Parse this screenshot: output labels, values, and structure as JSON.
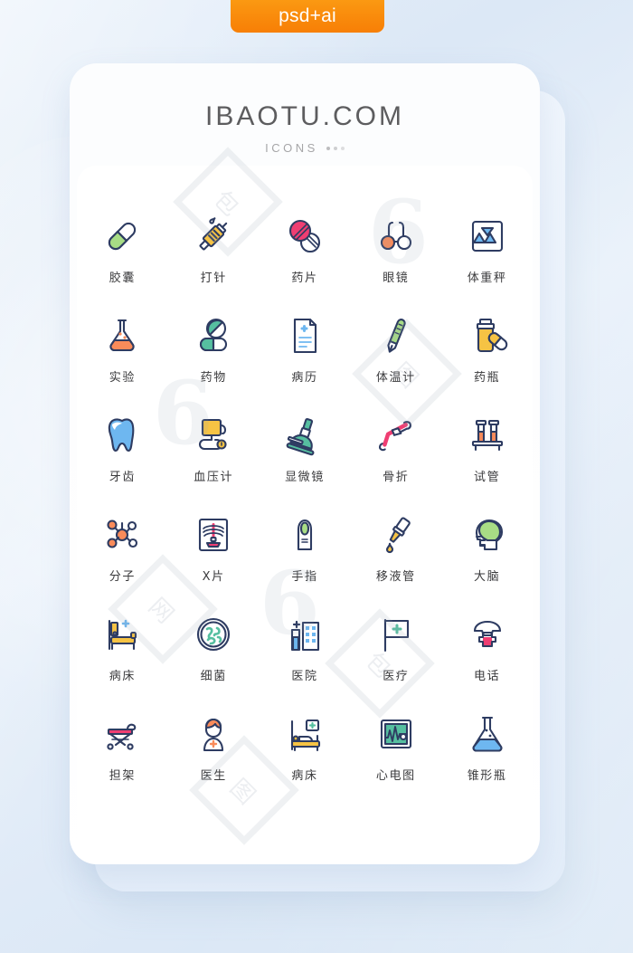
{
  "badge": {
    "label": "psd+ai"
  },
  "card": {
    "brand_title": "IBAOTU.COM",
    "brand_subtitle": "ICONS"
  },
  "colors": {
    "badge_orange": "#f98a0b",
    "outline_navy": "#2e3c62",
    "green": "#a8dd85",
    "teal": "#56bfa0",
    "pink": "#ef3e72",
    "orange": "#f98b5a",
    "yellow": "#f6c344",
    "blue": "#6eb7f0",
    "background": "#dfeaf7",
    "label_text": "#3a3a3c",
    "title_text": "#5d5d5f"
  },
  "watermarks": {
    "logo_text": "6",
    "box_text": "包图网",
    "site_text": "网"
  },
  "icons": [
    {
      "id": "capsule",
      "name": "capsule-icon",
      "label": "胶囊"
    },
    {
      "id": "injection",
      "name": "syringe-icon",
      "label": "打针"
    },
    {
      "id": "pills",
      "name": "pills-icon",
      "label": "药片"
    },
    {
      "id": "glasses",
      "name": "glasses-icon",
      "label": "眼镜"
    },
    {
      "id": "scale",
      "name": "weight-scale-icon",
      "label": "体重秤"
    },
    {
      "id": "flask",
      "name": "lab-flask-icon",
      "label": "实验"
    },
    {
      "id": "medicine",
      "name": "medicine-icon",
      "label": "药物"
    },
    {
      "id": "record",
      "name": "medical-record-icon",
      "label": "病历"
    },
    {
      "id": "thermometer",
      "name": "thermometer-icon",
      "label": "体温计"
    },
    {
      "id": "medbottle",
      "name": "medicine-bottle-icon",
      "label": "药瓶"
    },
    {
      "id": "tooth",
      "name": "tooth-icon",
      "label": "牙齿"
    },
    {
      "id": "bpmonitor",
      "name": "blood-pressure-icon",
      "label": "血压计"
    },
    {
      "id": "microscope",
      "name": "microscope-icon",
      "label": "显微镜"
    },
    {
      "id": "fracture",
      "name": "bone-fracture-icon",
      "label": "骨折"
    },
    {
      "id": "testtube",
      "name": "test-tube-icon",
      "label": "试管"
    },
    {
      "id": "molecule",
      "name": "molecule-icon",
      "label": "分子"
    },
    {
      "id": "xray",
      "name": "xray-icon",
      "label": "X片"
    },
    {
      "id": "finger",
      "name": "finger-icon",
      "label": "手指"
    },
    {
      "id": "pipette",
      "name": "pipette-icon",
      "label": "移液管"
    },
    {
      "id": "brain",
      "name": "brain-icon",
      "label": "大脑"
    },
    {
      "id": "sickbed1",
      "name": "hospital-bed-icon",
      "label": "病床"
    },
    {
      "id": "bacteria",
      "name": "bacteria-icon",
      "label": "细菌"
    },
    {
      "id": "hospital",
      "name": "hospital-icon",
      "label": "医院"
    },
    {
      "id": "medicalflag",
      "name": "medical-flag-icon",
      "label": "医疗"
    },
    {
      "id": "phone",
      "name": "emergency-phone-icon",
      "label": "电话"
    },
    {
      "id": "stretcher",
      "name": "stretcher-icon",
      "label": "担架"
    },
    {
      "id": "doctor",
      "name": "doctor-icon",
      "label": "医生"
    },
    {
      "id": "sickbed2",
      "name": "patient-bed-icon",
      "label": "病床"
    },
    {
      "id": "ecg",
      "name": "ecg-monitor-icon",
      "label": "心电图"
    },
    {
      "id": "conicalflask",
      "name": "conical-flask-icon",
      "label": "锥形瓶"
    }
  ]
}
